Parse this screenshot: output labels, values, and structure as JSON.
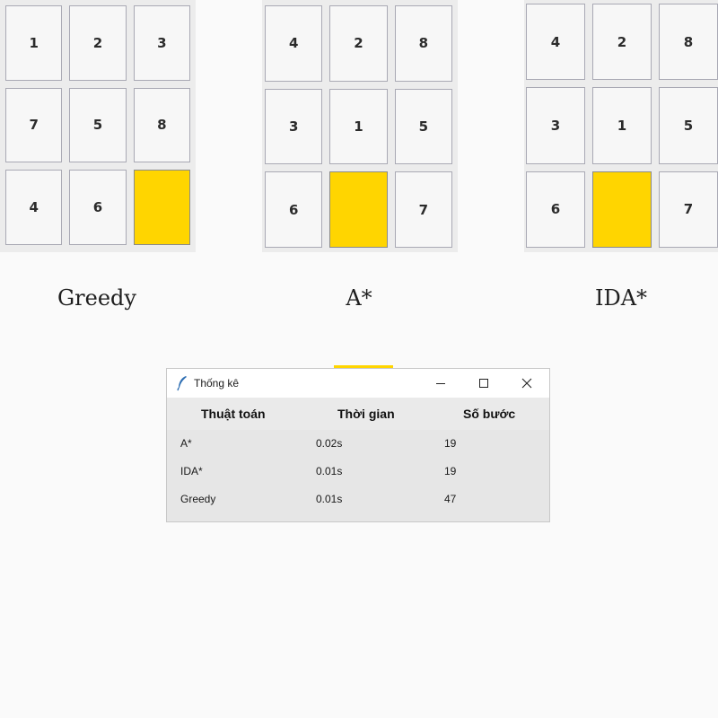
{
  "boards": {
    "greedy": {
      "tiles": [
        "1",
        "2",
        "3",
        "7",
        "5",
        "8",
        "4",
        "6",
        ""
      ],
      "label": "Greedy"
    },
    "astar": {
      "tiles": [
        "4",
        "2",
        "8",
        "3",
        "1",
        "5",
        "6",
        "",
        "7"
      ],
      "label": "A*"
    },
    "ida": {
      "tiles": [
        "4",
        "2",
        "8",
        "3",
        "1",
        "5",
        "6",
        "",
        "7"
      ],
      "label": "IDA*"
    }
  },
  "colors": {
    "blank_tile": "#ffd500",
    "tile": "#f7f7f7",
    "tile_border": "#a9a9b4"
  },
  "stats_window": {
    "title": "Thống kê",
    "icon": "feather-icon",
    "headers": {
      "algorithm": "Thuật toán",
      "time": "Thời gian",
      "steps": "Số bước"
    },
    "rows": [
      {
        "algorithm": "A*",
        "time": "0.02s",
        "steps": "19"
      },
      {
        "algorithm": "IDA*",
        "time": "0.01s",
        "steps": "19"
      },
      {
        "algorithm": "Greedy",
        "time": "0.01s",
        "steps": "47"
      }
    ]
  }
}
